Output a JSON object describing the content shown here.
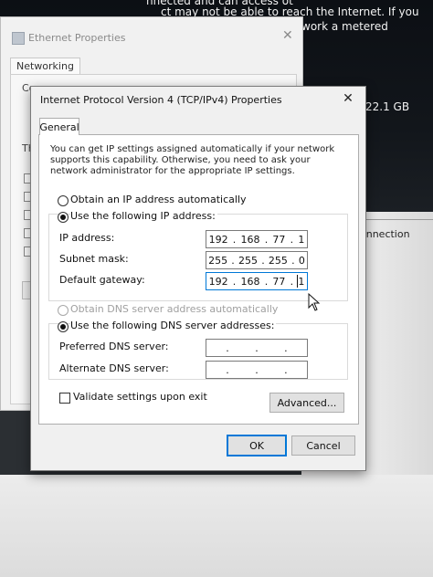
{
  "background": {
    "line1": "nnected and can access ot",
    "line2": "ct may not be able to reach the Internet. If you",
    "line3": "work a metered",
    "storage": "22.1 GB",
    "connection": "onnection",
    "eth_window_title": "Ethernet Properties",
    "eth_tab": "Networking",
    "partial_co": "Co",
    "partial_th": "Th"
  },
  "dialog": {
    "title": "Internet Protocol Version 4 (TCP/IPv4) Properties",
    "close_glyph": "✕",
    "tab_general": "General",
    "description": "You can get IP settings assigned automatically if your network supports this capability. Otherwise, you need to ask your network administrator for the appropriate IP settings.",
    "obtain_ip_auto": "Obtain an IP address automatically",
    "use_following_ip": "Use the following IP address:",
    "ip_address_label": "IP address:",
    "subnet_mask_label": "Subnet mask:",
    "default_gateway_label": "Default gateway:",
    "ip_address": [
      "192",
      "168",
      "77",
      "1"
    ],
    "subnet_mask": [
      "255",
      "255",
      "255",
      "0"
    ],
    "default_gateway": [
      "192",
      "168",
      "77",
      "1"
    ],
    "obtain_dns_auto": "Obtain DNS server address automatically",
    "use_following_dns": "Use the following DNS server addresses:",
    "preferred_dns_label": "Preferred DNS server:",
    "alternate_dns_label": "Alternate DNS server:",
    "preferred_dns": [
      "",
      "",
      "",
      ""
    ],
    "alternate_dns": [
      "",
      "",
      "",
      ""
    ],
    "validate_on_exit": "Validate settings upon exit",
    "advanced_button": "Advanced...",
    "ok_button": "OK",
    "cancel_button": "Cancel",
    "selected_ip_mode": "manual",
    "selected_dns_mode": "manual",
    "validate_checked": false
  },
  "colors": {
    "accent": "#0078d7",
    "dialog_bg": "#f0f0f0"
  },
  "icons": {
    "window_close": "close-icon",
    "mouse_pointer": "pointer-icon"
  }
}
